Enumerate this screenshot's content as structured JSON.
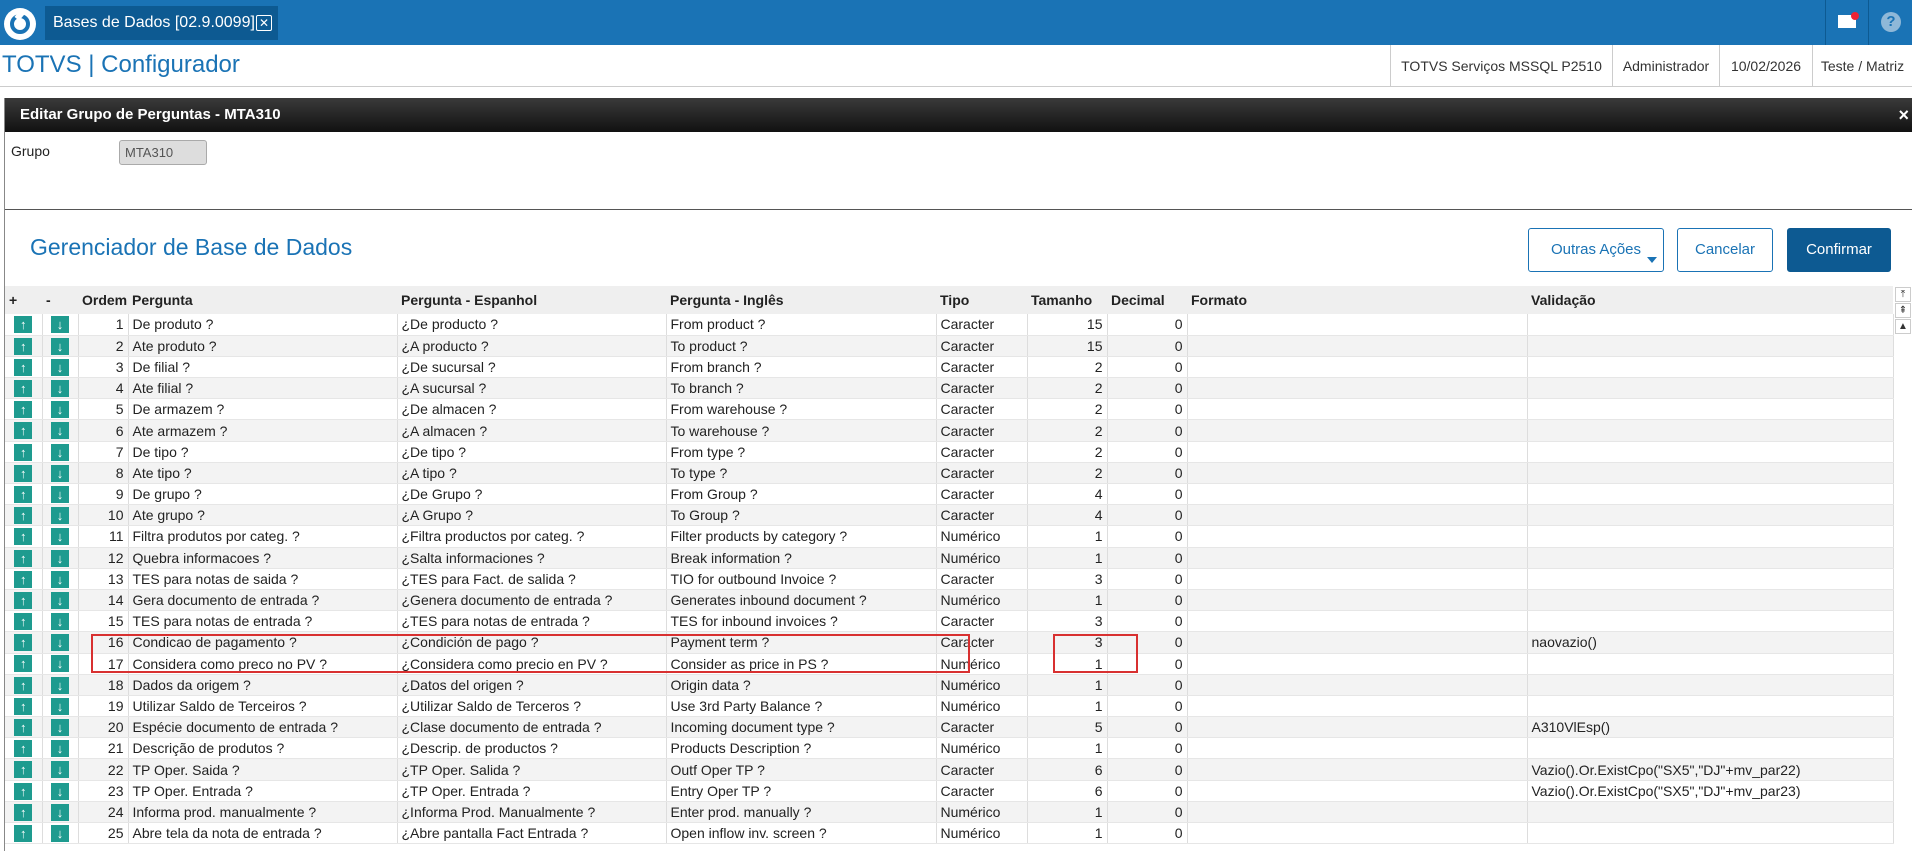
{
  "tab": {
    "title": "Bases de Dados [02.9.0099]",
    "close_glyph": "✕"
  },
  "header": {
    "app_title": "TOTVS | Configurador",
    "environment": "TOTVS Serviços MSSQL P2510",
    "user": "Administrador",
    "date": "10/02/2026",
    "company": "Teste / Matriz"
  },
  "dialog": {
    "title": "Editar Grupo de Perguntas - MTA310",
    "close_glyph": "×",
    "grupo_label": "Grupo",
    "grupo_value": "MTA310",
    "manager_title": "Gerenciador de Base de Dados",
    "buttons": {
      "other_actions": "Outras Ações",
      "cancel": "Cancelar",
      "confirm": "Confirmar"
    }
  },
  "grid": {
    "columns": [
      "+",
      "-",
      "Ordem",
      "Pergunta",
      "Pergunta - Espanhol",
      "Pergunta - Inglês",
      "Tipo",
      "Tamanho",
      "Decimal",
      "Formato",
      "Validação"
    ],
    "up_glyph": "↑",
    "down_glyph": "↓",
    "rows": [
      [
        "1",
        "De produto ?",
        "¿De producto ?",
        "From product ?",
        "Caracter",
        "15",
        "0",
        "",
        ""
      ],
      [
        "2",
        "Ate produto ?",
        "¿A producto ?",
        "To product ?",
        "Caracter",
        "15",
        "0",
        "",
        ""
      ],
      [
        "3",
        "De filial ?",
        "¿De sucursal ?",
        "From branch ?",
        "Caracter",
        "2",
        "0",
        "",
        ""
      ],
      [
        "4",
        "Ate filial ?",
        "¿A sucursal ?",
        "To branch ?",
        "Caracter",
        "2",
        "0",
        "",
        ""
      ],
      [
        "5",
        "De armazem ?",
        "¿De almacen ?",
        "From warehouse ?",
        "Caracter",
        "2",
        "0",
        "",
        ""
      ],
      [
        "6",
        "Ate armazem ?",
        "¿A almacen ?",
        "To warehouse ?",
        "Caracter",
        "2",
        "0",
        "",
        ""
      ],
      [
        "7",
        "De tipo ?",
        "¿De tipo ?",
        "From type ?",
        "Caracter",
        "2",
        "0",
        "",
        ""
      ],
      [
        "8",
        "Ate tipo ?",
        "¿A tipo ?",
        "To type ?",
        "Caracter",
        "2",
        "0",
        "",
        ""
      ],
      [
        "9",
        "De grupo ?",
        "¿De Grupo ?",
        "From Group ?",
        "Caracter",
        "4",
        "0",
        "",
        ""
      ],
      [
        "10",
        "Ate grupo ?",
        "¿A Grupo ?",
        "To Group ?",
        "Caracter",
        "4",
        "0",
        "",
        ""
      ],
      [
        "11",
        "Filtra produtos por categ. ?",
        "¿Filtra productos por categ. ?",
        "Filter products by category ?",
        "Numérico",
        "1",
        "0",
        "",
        ""
      ],
      [
        "12",
        "Quebra informacoes ?",
        "¿Salta informaciones ?",
        "Break information ?",
        "Numérico",
        "1",
        "0",
        "",
        ""
      ],
      [
        "13",
        "TES para notas de saida ?",
        "¿TES para Fact. de salida ?",
        "TIO for outbound Invoice ?",
        "Caracter",
        "3",
        "0",
        "",
        ""
      ],
      [
        "14",
        "Gera documento de entrada ?",
        "¿Genera documento de entrada ?",
        "Generates inbound document ?",
        "Numérico",
        "1",
        "0",
        "",
        ""
      ],
      [
        "15",
        "TES para notas de entrada ?",
        "¿TES para notas de entrada ?",
        "TES for inbound invoices ?",
        "Caracter",
        "3",
        "0",
        "",
        ""
      ],
      [
        "16",
        "Condicao de pagamento ?",
        "¿Condición de pago ?",
        "Payment term ?",
        "Caracter",
        "3",
        "0",
        "",
        "naovazio()"
      ],
      [
        "17",
        "Considera como preco no PV ?",
        "¿Considera como precio en PV ?",
        "Consider as price in PS ?",
        "Numérico",
        "1",
        "0",
        "",
        ""
      ],
      [
        "18",
        "Dados da origem ?",
        "¿Datos del origen ?",
        "Origin data ?",
        "Numérico",
        "1",
        "0",
        "",
        ""
      ],
      [
        "19",
        "Utilizar Saldo de Terceiros ?",
        "¿Utilizar Saldo de Terceros ?",
        "Use 3rd Party Balance ?",
        "Numérico",
        "1",
        "0",
        "",
        ""
      ],
      [
        "20",
        "Espécie documento de entrada ?",
        "¿Clase documento de entrada ?",
        "Incoming document type ?",
        "Caracter",
        "5",
        "0",
        "",
        "A310VlEsp()"
      ],
      [
        "21",
        "Descrição de produtos ?",
        "¿Descrip. de productos ?",
        "Products Description ?",
        "Numérico",
        "1",
        "0",
        "",
        ""
      ],
      [
        "22",
        "TP Oper. Saida ?",
        "¿TP Oper. Salida ?",
        "Outf Oper TP ?",
        "Caracter",
        "6",
        "0",
        "",
        "Vazio().Or.ExistCpo(\"SX5\",\"DJ\"+mv_par22)"
      ],
      [
        "23",
        "TP Oper. Entrada ?",
        "¿TP Oper. Entrada ?",
        "Entry Oper TP ?",
        "Caracter",
        "6",
        "0",
        "",
        "Vazio().Or.ExistCpo(\"SX5\",\"DJ\"+mv_par23)"
      ],
      [
        "24",
        "Informa prod. manualmente ?",
        "¿Informa Prod. Manualmente ?",
        "Enter prod. manually ?",
        "Numérico",
        "1",
        "0",
        "",
        ""
      ],
      [
        "25",
        "Abre tela da nota de entrada ?",
        "¿Abre pantalla Fact Entrada ?",
        "Open inflow inv. screen ?",
        "Numérico",
        "1",
        "0",
        "",
        ""
      ]
    ]
  },
  "scroll_glyphs": {
    "first": "⤒",
    "prev_page": "⇞",
    "prev": "▲"
  },
  "colors": {
    "brand": "#1a73b5",
    "arrow": "#1e9b8f",
    "highlight": "#d83030"
  }
}
